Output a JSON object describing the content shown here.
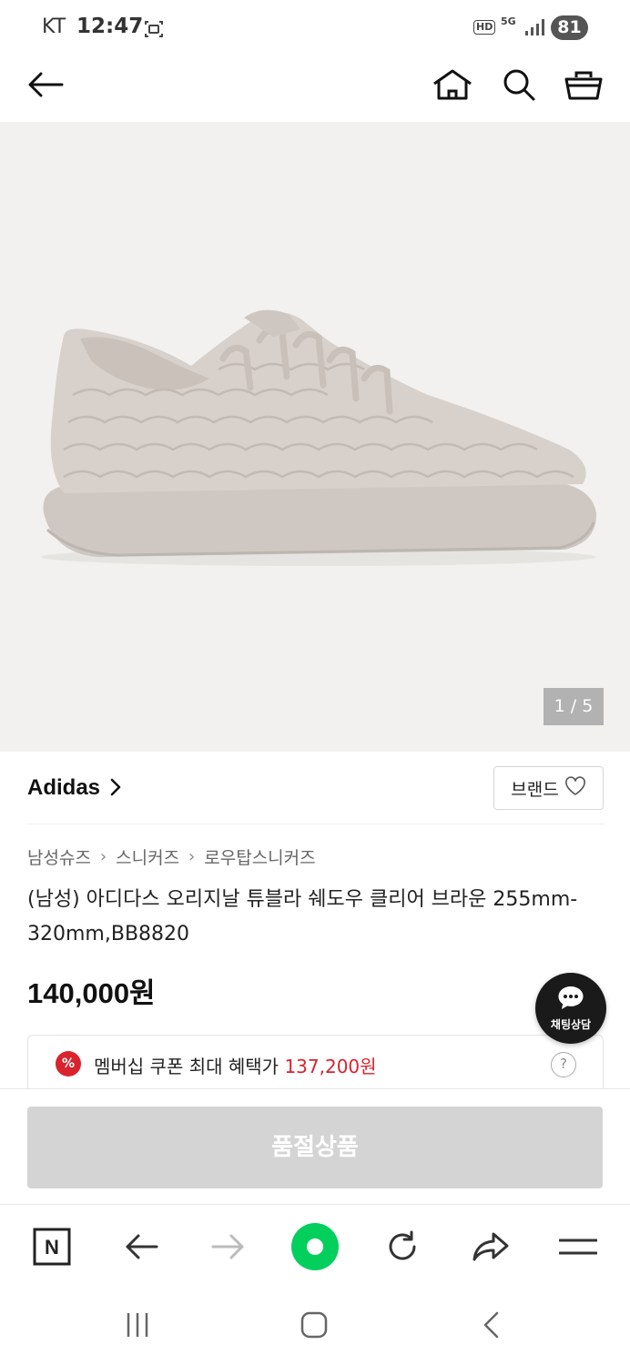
{
  "status_bar": {
    "carrier": "KT",
    "time": "12:47",
    "hd": "HD",
    "network": "5G",
    "battery": "81"
  },
  "top_nav": {
    "icons": [
      "back-arrow-icon",
      "home-icon",
      "search-icon",
      "basket-icon"
    ]
  },
  "product": {
    "image_indicator": "1 / 5",
    "brand": "Adidas",
    "brand_button_label": "브랜드",
    "breadcrumb": [
      "남성슈즈",
      "스니커즈",
      "로우탑스니커즈"
    ],
    "title": "(남성) 아디다스 오리지날 튜블라 쉐도우 클리어 브라운 255mm-320mm,BB8820",
    "price": "140,000원",
    "coupon": {
      "badge": "%",
      "label": "멤버십 쿠폰 최대 혜택가",
      "price": "137,200원",
      "help": "?"
    }
  },
  "chat_fab": {
    "label": "채팅상담"
  },
  "sold_out_button": "품절상품",
  "browser_toolbar": {
    "icons": [
      "naver-n-icon",
      "back-arrow-icon",
      "forward-arrow-icon",
      "green-circle-icon",
      "reload-icon",
      "share-icon",
      "menu-icon"
    ],
    "naver_letter": "N"
  },
  "colors": {
    "accent_red": "#d9232e",
    "chat_dark": "#1a1a1a",
    "naver_green": "#03cf5d",
    "sold_out_gray": "#d4d4d4"
  }
}
